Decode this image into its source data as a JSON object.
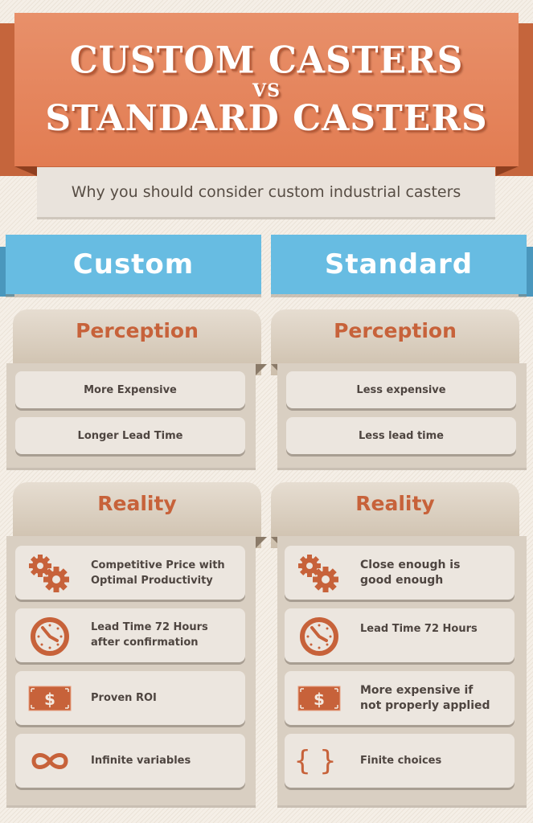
{
  "header": {
    "title_line1": "CUSTOM CASTERS",
    "title_vs": "VS",
    "title_line2": "STANDARD CASTERS",
    "subtitle": "Why you should consider custom industrial casters"
  },
  "columns": [
    {
      "heading": "Custom",
      "perception": {
        "title": "Perception",
        "items": [
          "More Expensive",
          "Longer Lead Time"
        ]
      },
      "reality": {
        "title": "Reality",
        "items": [
          {
            "icon": "gears-icon",
            "line1": "Competitive Price with",
            "line2": "Optimal Productivity"
          },
          {
            "icon": "clock-icon",
            "line1": "Lead Time 72 Hours",
            "line2": "after confirmation"
          },
          {
            "icon": "dollar-bill-icon",
            "line1": "Proven ROI",
            "line2": ""
          },
          {
            "icon": "infinity-icon",
            "line1": "Infinite variables",
            "line2": ""
          }
        ]
      }
    },
    {
      "heading": "Standard",
      "perception": {
        "title": "Perception",
        "items": [
          "Less expensive",
          "Less lead time"
        ]
      },
      "reality": {
        "title": "Reality",
        "items": [
          {
            "icon": "gears-icon",
            "line1": "Close enough is",
            "line2": "good enough"
          },
          {
            "icon": "clock-icon",
            "line1": "Lead Time 72 Hours",
            "line2": ""
          },
          {
            "icon": "dollar-bill-icon",
            "line1": "More expensive if",
            "line2": "not properly applied"
          },
          {
            "icon": "braces-icon",
            "line1": "Finite choices",
            "line2": ""
          }
        ]
      }
    }
  ],
  "colors": {
    "accent_orange": "#e27c52",
    "accent_blue": "#67bce2",
    "icon_color": "#c7623a",
    "text_dark": "#4e4540"
  }
}
